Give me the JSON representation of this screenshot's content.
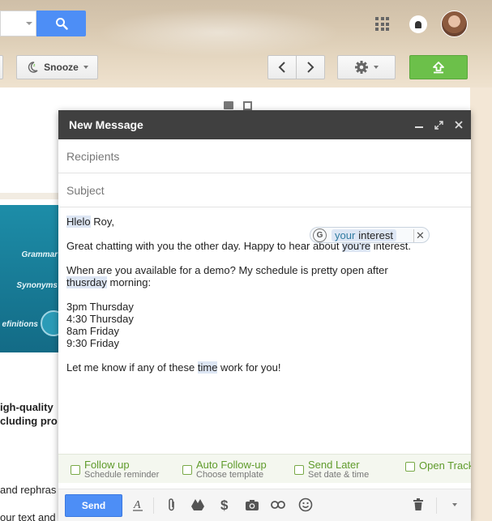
{
  "toolbar": {
    "snooze_label": "Snooze"
  },
  "background_email": {
    "promo_labels": [
      "Grammar",
      "Synonyms",
      "efinitions"
    ],
    "lines": [
      "igh-quality",
      "cluding pro",
      "and rephras",
      "our text and"
    ]
  },
  "compose": {
    "title": "New Message",
    "recipients_placeholder": "Recipients",
    "subject_placeholder": "Subject",
    "body": {
      "greeting_word": "Hlelo",
      "greeting_rest": " Roy,",
      "line2_pre": "Great chatting with you the other day. Happy to hear about ",
      "line2_hl": "you're",
      "line2_post": " interest.",
      "line3": "When are you available for a demo? My schedule is pretty open after",
      "line4_hl": "thusrday",
      "line4_post": " morning:",
      "times": [
        "3pm Thursday",
        "4:30 Thursday",
        "8am Friday",
        "9:30 Friday"
      ],
      "closing_pre": "Let me know if any of these ",
      "closing_hl": "time",
      "closing_post": " work for you!"
    },
    "suggestion": {
      "icon_letter": "G",
      "word1": "your",
      "word2": "interest"
    },
    "plugins": [
      {
        "title": "Follow up",
        "subtitle": "Schedule reminder"
      },
      {
        "title": "Auto Follow-up",
        "subtitle": "Choose template"
      },
      {
        "title": "Send Later",
        "subtitle": "Set date & time"
      },
      {
        "title": "Open Track",
        "subtitle": ""
      }
    ],
    "send_label": "Send"
  },
  "colors": {
    "accent_blue": "#4d8ef6",
    "send_green": "#6cc04a",
    "compose_header": "#404040",
    "plugin_green": "#5f9b2b"
  },
  "icons": [
    "search-icon",
    "apps-grid-icon",
    "notifications-bell-icon",
    "snooze-icon",
    "chevron-left-icon",
    "chevron-right-icon",
    "gear-icon",
    "send-upload-icon",
    "print-icon",
    "popout-icon",
    "minimize-icon",
    "expand-icon",
    "close-icon",
    "grammarly-icon",
    "format-text-icon",
    "attach-icon",
    "drive-icon",
    "money-icon",
    "camera-icon",
    "link-icon",
    "emoji-icon",
    "trash-icon",
    "more-options-icon"
  ]
}
